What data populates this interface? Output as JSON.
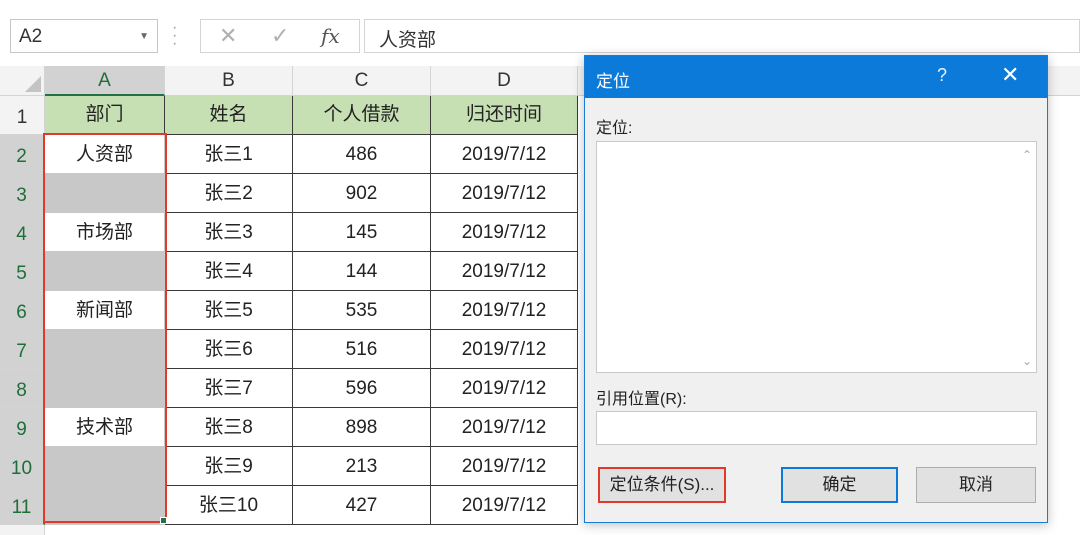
{
  "formula_bar": {
    "name_box": "A2",
    "dropdown_icon": "chevron-down-icon",
    "cancel_icon": "✕",
    "enter_icon": "✓",
    "fx_label": "fx",
    "formula_value": "人资部"
  },
  "sheet": {
    "column_headers": [
      "A",
      "B",
      "C",
      "D"
    ],
    "row_headers": [
      "1",
      "2",
      "3",
      "4",
      "5",
      "6",
      "7",
      "8",
      "9",
      "10",
      "11"
    ],
    "table_headers": [
      "部门",
      "姓名",
      "个人借款",
      "归还时间"
    ],
    "rows": [
      [
        "人资部",
        "张三1",
        "486",
        "2019/7/12"
      ],
      [
        "",
        "张三2",
        "902",
        "2019/7/12"
      ],
      [
        "市场部",
        "张三3",
        "145",
        "2019/7/12"
      ],
      [
        "",
        "张三4",
        "144",
        "2019/7/12"
      ],
      [
        "新闻部",
        "张三5",
        "535",
        "2019/7/12"
      ],
      [
        "",
        "张三6",
        "516",
        "2019/7/12"
      ],
      [
        "",
        "张三7",
        "596",
        "2019/7/12"
      ],
      [
        "技术部",
        "张三8",
        "898",
        "2019/7/12"
      ],
      [
        "",
        "张三9",
        "213",
        "2019/7/12"
      ],
      [
        "",
        "张三10",
        "427",
        "2019/7/12"
      ]
    ],
    "header_fill": "#c6e0b4",
    "selection_border": "#e23a2a"
  },
  "dialog": {
    "title": "定位",
    "help_label": "?",
    "close_label": "✕",
    "goto_label": "定位:",
    "reference_label": "引用位置(R):",
    "reference_value": "",
    "special_button": "定位条件(S)...",
    "ok_button": "确定",
    "cancel_button": "取消",
    "title_color": "#0b7ad8"
  }
}
